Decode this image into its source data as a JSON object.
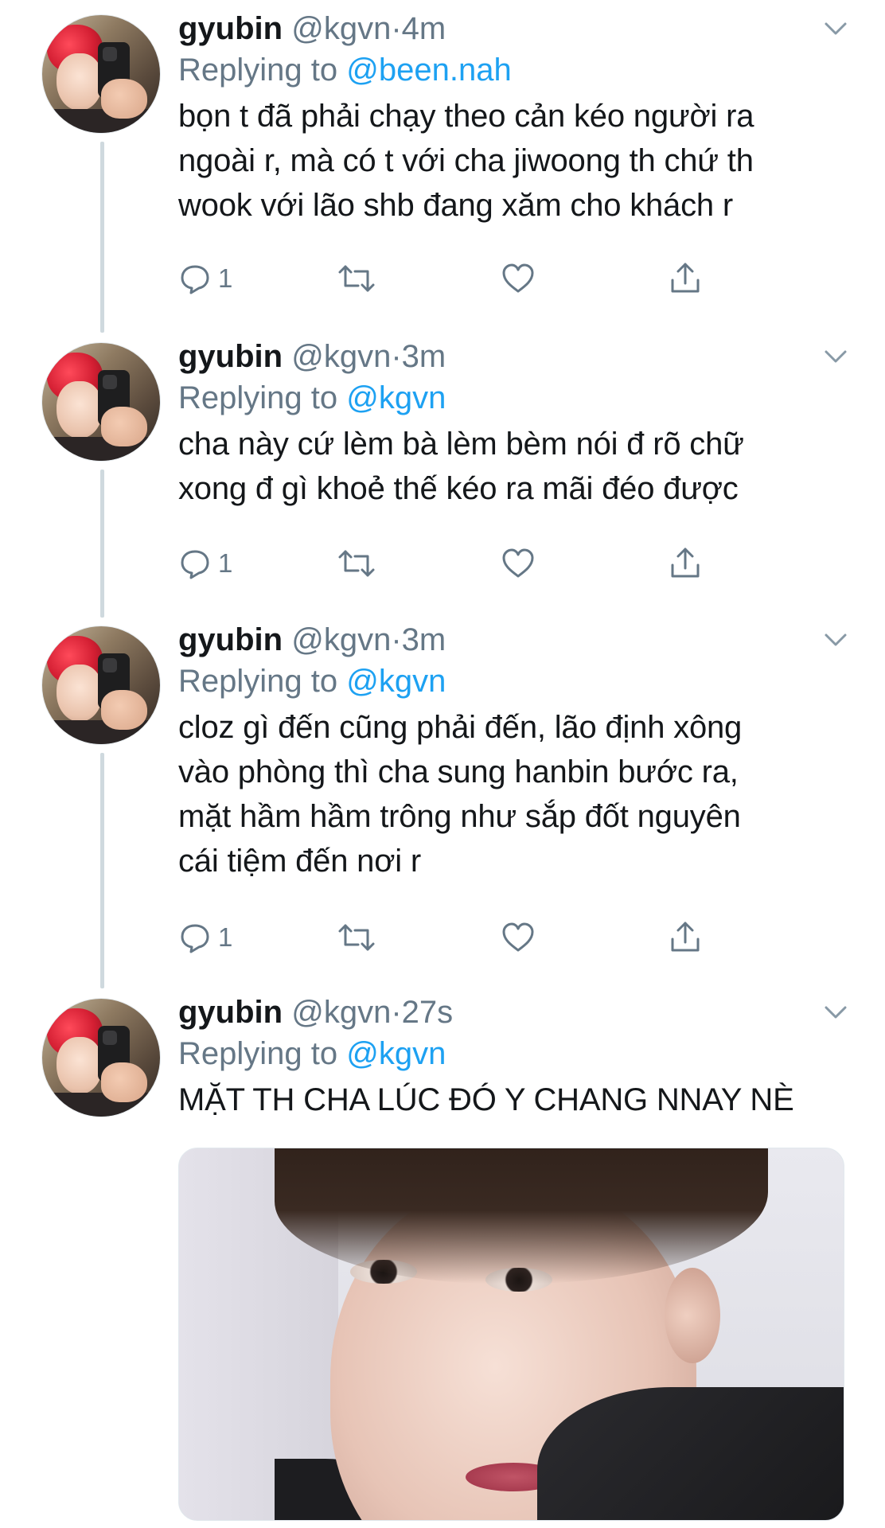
{
  "colors": {
    "text": "#14171a",
    "muted": "#657786",
    "link": "#1da1f2",
    "thread_line": "#cfd9de"
  },
  "tweets": [
    {
      "author": "gyubin",
      "handle": "@kgvn",
      "dot": "·",
      "time": "4m",
      "replying_prefix": "Replying to",
      "replying_to": "@been.nah",
      "text": "bọn t đã phải chạy theo cản kéo người ra\nngoài r, mà có t với cha jiwoong th chứ th\nwook với lão shb đang xăm cho khách r",
      "reply_count": "1",
      "icons": [
        "reply-icon",
        "retweet-icon",
        "like-icon",
        "share-icon",
        "chevron-down-icon"
      ]
    },
    {
      "author": "gyubin",
      "handle": "@kgvn",
      "dot": "·",
      "time": "3m",
      "replying_prefix": "Replying to",
      "replying_to": "@kgvn",
      "text": "cha này cứ lèm bà lèm bèm nói đ rõ chữ\nxong đ gì khoẻ thế kéo ra mãi đéo được",
      "reply_count": "1",
      "icons": [
        "reply-icon",
        "retweet-icon",
        "like-icon",
        "share-icon",
        "chevron-down-icon"
      ]
    },
    {
      "author": "gyubin",
      "handle": "@kgvn",
      "dot": "·",
      "time": "3m",
      "replying_prefix": "Replying to",
      "replying_to": "@kgvn",
      "text": "cloz gì đến cũng phải đến, lão định xông\nvào phòng thì cha sung hanbin bước ra,\nmặt hầm hầm trông như sắp đốt nguyên\ncái tiệm đến nơi r",
      "reply_count": "1",
      "icons": [
        "reply-icon",
        "retweet-icon",
        "like-icon",
        "share-icon",
        "chevron-down-icon"
      ]
    },
    {
      "author": "gyubin",
      "handle": "@kgvn",
      "dot": "·",
      "time": "27s",
      "replying_prefix": "Replying to",
      "replying_to": "@kgvn",
      "text": "MẶT TH CHA LÚC ĐÓ Y CHANG NNAY NÈ",
      "icons": [
        "chevron-down-icon"
      ]
    }
  ]
}
